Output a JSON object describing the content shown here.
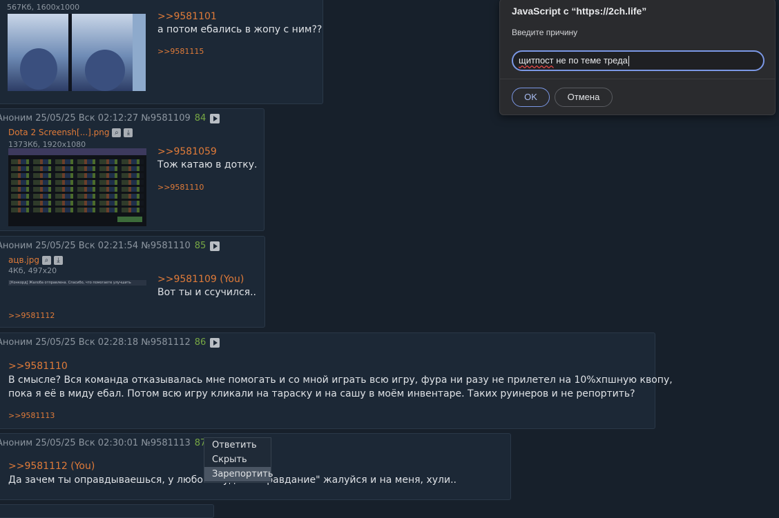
{
  "posts": [
    {
      "file_meta": "567Кб, 1600x1000",
      "quote": ">>9581101",
      "text": "а потом ебались в жопу с ним??",
      "reply": ">>9581115"
    },
    {
      "header": "Аноним 25/05/25 Вск 02:12:27 №9581109",
      "count": "84",
      "file_name": "Dota 2 Screensh[...].png",
      "file_meta": "1373Кб, 1920x1080",
      "quote": ">>9581059",
      "text": "Тож катаю в дотку.",
      "reply": ">>9581110"
    },
    {
      "header": "Аноним 25/05/25 Вск 02:21:54 №9581110",
      "count": "85",
      "file_name": "ацв.jpg",
      "file_meta": "4Кб, 497x20",
      "thumb_text": "[Конкорд] Жалоба отправлена. Спасибо, что помогаете улучшить",
      "quote": ">>9581109 (You)",
      "text": "Вот ты и ссучился..",
      "reply": ">>9581112"
    },
    {
      "header": "Аноним 25/05/25 Вск 02:28:18 №9581112",
      "count": "86",
      "quote": ">>9581110",
      "text_line1": "В смысле? Вся команда отказывалась мне помогать и со мной играть всю игру, фура ни разу не прилетел на 10%хпшную квопу,",
      "text_line2": "пока я её в миду ебал. Потом всю игру кликали на тараску и на сашу в моём инвентаре. Таких руинеров и не репортить?",
      "reply": ">>9581113"
    },
    {
      "header": "Аноним 25/05/25 Вск 02:30:01 №9581113",
      "count": "87",
      "quote": ">>9581112 (You)",
      "text": "Да зачем ты оправдываешься, у любого будет \"оправдание\" жалуйся и на меня, хули.."
    }
  ],
  "context_menu": {
    "items": [
      "Ответить",
      "Скрыть",
      "Зарепортить"
    ],
    "highlighted": "Зарепортить"
  },
  "dialog": {
    "title": "JavaScript с “https://2ch.life”",
    "prompt": "Введите причину",
    "input_misspelled": "щитпост",
    "input_rest": " не по теме треда",
    "ok_label": "OK",
    "cancel_label": "Отмена"
  },
  "icons": [
    "search-icon",
    "download-icon",
    "play-icon"
  ],
  "colors": {
    "background": "#17202b",
    "post_bg": "#1c2836",
    "link": "#e07b39",
    "post_count": "#77a844",
    "dialog_accent": "#7b98e6"
  }
}
